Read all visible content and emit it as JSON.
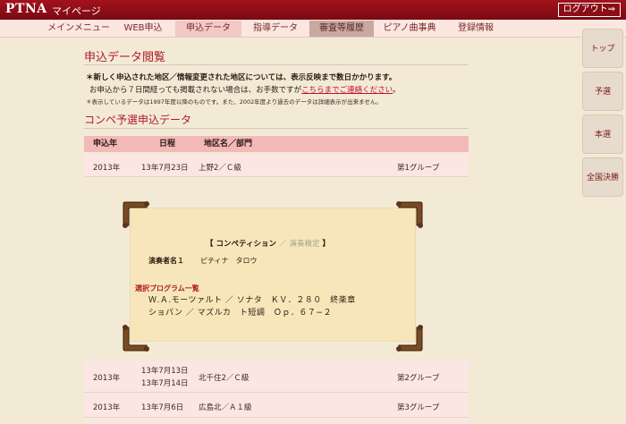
{
  "header": {
    "logo": "PTNA",
    "mypage": "マイページ",
    "logout": "ログアウト⇒"
  },
  "nav": [
    {
      "label": "メインメニュー",
      "state": "normal"
    },
    {
      "label": "WEB申込",
      "state": "normal"
    },
    {
      "label": "申込データ",
      "state": "selected"
    },
    {
      "label": "指導データ",
      "state": "normal"
    },
    {
      "label": "審査等履歴",
      "state": "current"
    },
    {
      "label": "ピアノ曲事典",
      "state": "normal"
    },
    {
      "label": "登録情報",
      "state": "normal"
    }
  ],
  "side": [
    "トップ",
    "予選",
    "本選",
    "全国決勝"
  ],
  "page": {
    "title": "申込データ閲覧",
    "notice1": "＊新しく申込された地区／情報変更された地区については、表示反映まで数日かかります。",
    "notice2_pre": "お申込から７日間経っても掲載されない場合は、お手数ですが",
    "notice2_link": "こちらまでご連絡ください",
    "notice2_post": "。",
    "notice3": "＊表示しているデータは1997年度以降のものです。また、2002年度より過去のデータは詳細表示が出来ません。",
    "section_title": "コンペ予選申込データ"
  },
  "table": {
    "headers": [
      "申込年",
      "日程",
      "地区名／部門"
    ],
    "rows": [
      {
        "year": "2013年",
        "date1": "13年7月23日",
        "date2": "",
        "area": "上野2／Ｃ級",
        "group": "第1グループ"
      },
      {
        "year": "2013年",
        "date1": "13年7月13日",
        "date2": "13年7月14日",
        "area": "北千住2／Ｃ級",
        "group": "第2グループ"
      },
      {
        "year": "2013年",
        "date1": "13年7月6日",
        "date2": "",
        "area": "広島北／Ａ１級",
        "group": "第3グループ"
      }
    ]
  },
  "card": {
    "bracket_open": "【",
    "category": "コンペティション",
    "sep": "／",
    "type": "演奏検定",
    "bracket_close": "】",
    "performer_label": "演奏者名１",
    "performer_name": "ピティナ　タロウ",
    "program_title": "選択プログラム一覧",
    "program": [
      "Ｗ.Ａ.モーツァルト ／ ソナタ　ＫＶ．２８０　終楽章",
      "ショパン ／ マズルカ　ト短調　Ｏｐ．６７−２"
    ]
  },
  "colors": {
    "brand": "#8a0e16",
    "accent": "#b01a2a",
    "background": "#f3ead6",
    "card": "#f6e6b9"
  }
}
